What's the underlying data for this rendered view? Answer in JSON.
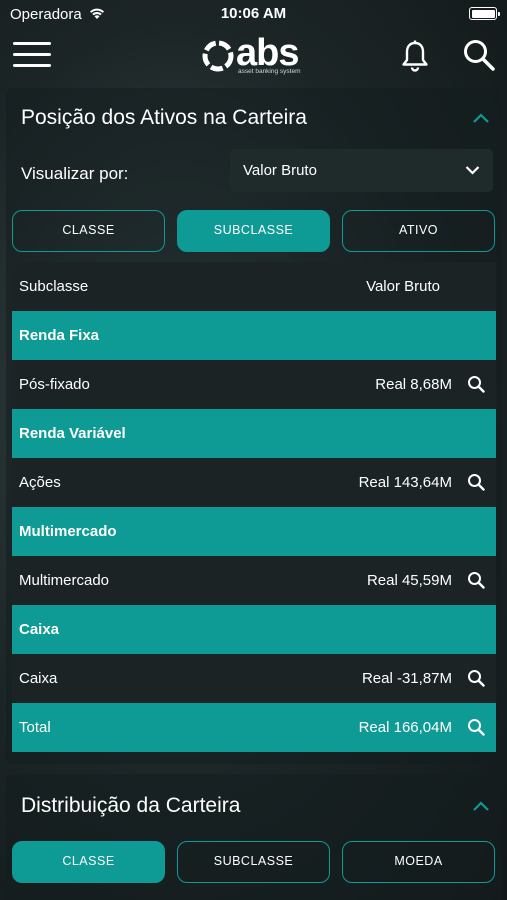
{
  "status_bar": {
    "carrier": "Operadora",
    "time": "10:06 AM"
  },
  "header": {
    "logo_text": "abs",
    "logo_subtitle": "asset banking system"
  },
  "position_card": {
    "title": "Posição dos Ativos na Carteira",
    "view_label": "Visualizar por:",
    "view_value": "Valor Bruto",
    "segments": [
      {
        "label": "CLASSE",
        "active": false
      },
      {
        "label": "SUBCLASSE",
        "active": true
      },
      {
        "label": "ATIVO",
        "active": false
      }
    ],
    "table": {
      "headers": {
        "left": "Subclasse",
        "right": "Valor Bruto"
      },
      "rows": [
        {
          "type": "group",
          "label": "Renda Fixa"
        },
        {
          "type": "item",
          "label": "Pós-fixado",
          "value": "Real 8,68M"
        },
        {
          "type": "group",
          "label": "Renda Variável"
        },
        {
          "type": "item",
          "label": "Ações",
          "value": "Real 143,64M"
        },
        {
          "type": "group",
          "label": "Multimercado"
        },
        {
          "type": "item",
          "label": "Multimercado",
          "value": "Real 45,59M"
        },
        {
          "type": "group",
          "label": "Caixa"
        },
        {
          "type": "item",
          "label": "Caixa",
          "value": "Real -31,87M"
        }
      ],
      "total": {
        "label": "Total",
        "value": "Real 166,04M"
      }
    }
  },
  "distribution_card": {
    "title": "Distribuição da Carteira",
    "segments": [
      {
        "label": "CLASSE",
        "active": true
      },
      {
        "label": "SUBCLASSE",
        "active": false
      },
      {
        "label": "MOEDA",
        "active": false
      }
    ]
  },
  "colors": {
    "accent": "#0e9a95",
    "row_dark": "#1b2324",
    "background": "#1c2526"
  },
  "icons": [
    "wifi-icon",
    "battery-icon",
    "menu-icon",
    "logo-mark-icon",
    "bell-icon",
    "search-icon",
    "chevron-up-icon",
    "chevron-down-icon"
  ]
}
